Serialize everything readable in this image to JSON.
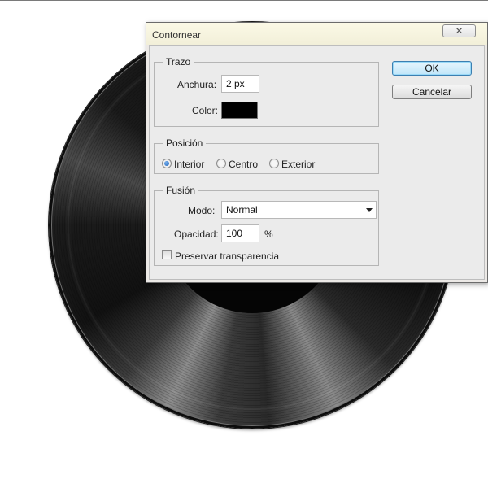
{
  "dialog": {
    "title": "Contornear",
    "close_glyph": "✕",
    "buttons": {
      "ok": "OK",
      "cancel": "Cancelar"
    }
  },
  "trazo": {
    "group_title": "Trazo",
    "width_label": "Anchura:",
    "width_value": "2 px",
    "color_label": "Color:",
    "color_value": "#000000"
  },
  "posicion": {
    "group_title": "Posición",
    "options": [
      "Interior",
      "Centro",
      "Exterior"
    ],
    "selected": "Interior"
  },
  "fusion": {
    "group_title": "Fusión",
    "mode_label": "Modo:",
    "mode_value": "Normal",
    "opacity_label": "Opacidad:",
    "opacity_value": "100",
    "opacity_unit": "%",
    "preserve_label": "Preservar transparencia",
    "preserve_checked": false
  },
  "icons": [
    "close-icon",
    "radio-icon",
    "dropdown-arrow-icon",
    "checkbox-icon"
  ],
  "colors": {
    "accent": "#3c7fb1",
    "dialog_bg": "#ebebeb",
    "titlebar": "#fbf9e6"
  }
}
